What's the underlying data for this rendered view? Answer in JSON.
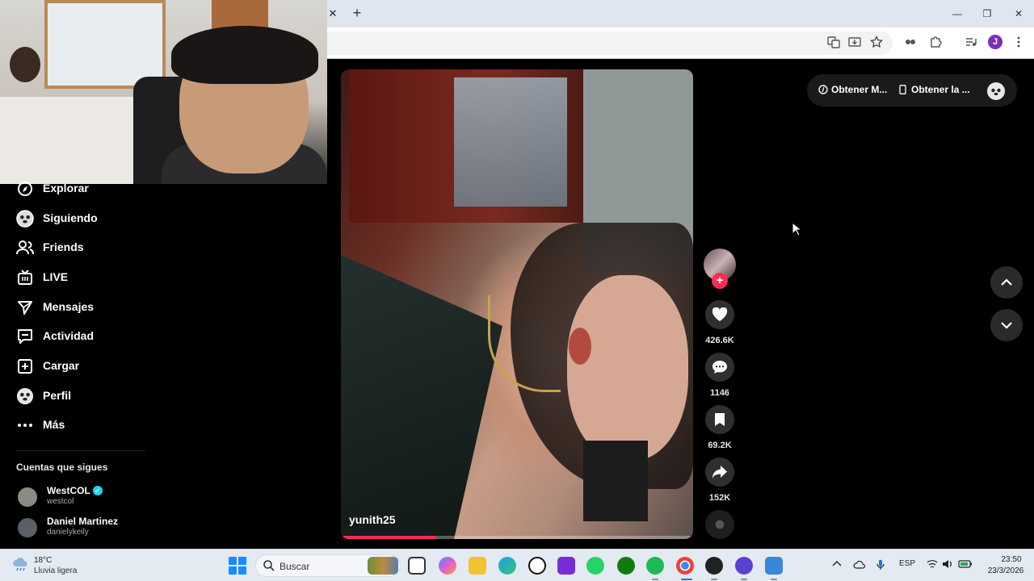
{
  "browser": {
    "tab_close": "✕",
    "new_tab": "+",
    "window_controls": [
      "—",
      "❐",
      "✕"
    ],
    "profile_initial": "J"
  },
  "sidebar": {
    "items": [
      {
        "label": "Explorar",
        "icon": "compass-icon"
      },
      {
        "label": "Siguiendo",
        "icon": "avatar"
      },
      {
        "label": "Friends",
        "icon": "friends-icon"
      },
      {
        "label": "LIVE",
        "icon": "live-icon"
      },
      {
        "label": "Mensajes",
        "icon": "send-icon"
      },
      {
        "label": "Actividad",
        "icon": "activity-icon"
      },
      {
        "label": "Cargar",
        "icon": "upload-icon"
      },
      {
        "label": "Perfil",
        "icon": "avatar"
      },
      {
        "label": "Más",
        "icon": "more-icon"
      }
    ],
    "following_heading": "Cuentas que sigues",
    "following": [
      {
        "name": "WestCOL",
        "username": "westcol",
        "verified": true
      },
      {
        "name": "Daniel Martinez",
        "username": "danielykeily",
        "verified": false
      }
    ]
  },
  "video": {
    "author": "yunith25",
    "progress": 0.27
  },
  "actions": {
    "follow_glyph": "+",
    "likes": "426.6K",
    "comments": "1146",
    "saves": "69.2K",
    "shares": "152K"
  },
  "topbar": {
    "coins_label": "Obtener M...",
    "app_label": "Obtener la ..."
  },
  "taskbar": {
    "weather_temp": "18°C",
    "weather_desc": "Lluvia ligera",
    "search_placeholder": "Buscar",
    "language": "ESP",
    "time": "23:50",
    "date": "23/3/2026"
  },
  "colors": {
    "accent": "#fe2c55",
    "verified": "#20d5ec",
    "background": "#000000"
  }
}
